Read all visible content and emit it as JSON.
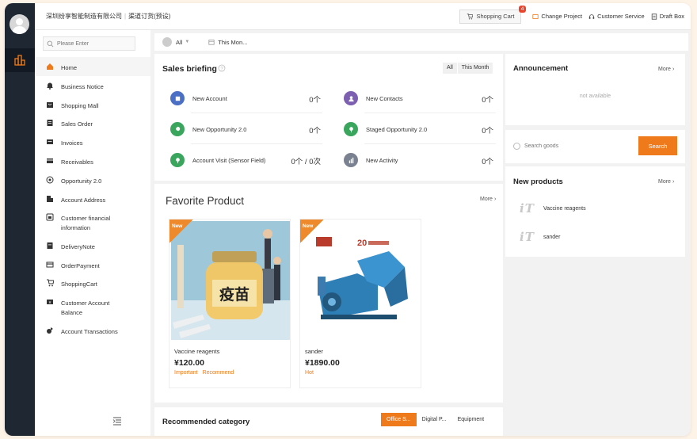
{
  "header": {
    "company": "深圳纷享智能制造有限公司",
    "channel": "渠道订货(预设)",
    "cart_label": "Shopping Cart",
    "cart_badge": "4",
    "change_project": "Change Project",
    "customer_service": "Customer Service",
    "draft_box": "Draft Box"
  },
  "sidebar": {
    "search_placeholder": "Please Enter",
    "items": [
      {
        "label": "Home",
        "icon": "home-icon"
      },
      {
        "label": "Business Notice",
        "icon": "bell-icon"
      },
      {
        "label": "Shopping Mall",
        "icon": "mall-icon"
      },
      {
        "label": "Sales Order",
        "icon": "order-icon"
      },
      {
        "label": "Invoices",
        "icon": "invoice-icon"
      },
      {
        "label": "Receivables",
        "icon": "receivables-icon"
      },
      {
        "label": "Opportunity 2.0",
        "icon": "target-icon"
      },
      {
        "label": "Account Address",
        "icon": "building-icon"
      },
      {
        "label": "Customer financial information",
        "icon": "finance-icon"
      },
      {
        "label": "DeliveryNote",
        "icon": "note-icon"
      },
      {
        "label": "OrderPayment",
        "icon": "payment-icon"
      },
      {
        "label": "ShoppingCart",
        "icon": "cart-icon"
      },
      {
        "label": "Customer Account Balance",
        "icon": "balance-icon"
      },
      {
        "label": "Account Transactions",
        "icon": "transactions-icon"
      }
    ]
  },
  "filter": {
    "owner": "All",
    "period": "This Mon..."
  },
  "briefing": {
    "title": "Sales briefing",
    "tabs": [
      "All",
      "This Month"
    ],
    "items": [
      {
        "label": "New Account",
        "value": "0个",
        "color": "#4a6fc4",
        "icon": "account-icon"
      },
      {
        "label": "New Contacts",
        "value": "0个",
        "color": "#7c5fb0",
        "icon": "contact-icon"
      },
      {
        "label": "New Opportunity 2.0",
        "value": "0个",
        "color": "#3aa55c",
        "icon": "opportunity-icon"
      },
      {
        "label": "Staged Opportunity 2.0",
        "value": "0个",
        "color": "#3aa55c",
        "icon": "staged-opportunity-icon"
      },
      {
        "label": "Account Visit (Sensor Field)",
        "value": "0个 / 0次",
        "color": "#3aa55c",
        "icon": "visit-icon"
      },
      {
        "label": "New Activity",
        "value": "0个",
        "color": "#7a8191",
        "icon": "activity-icon"
      }
    ]
  },
  "favorite": {
    "title": "Favorite Product",
    "more": "More",
    "products": [
      {
        "tag": "New",
        "name": "Vaccine reagents",
        "price": "¥120.00",
        "labels": [
          "Important",
          "Recommend"
        ],
        "img_text": "疫苗"
      },
      {
        "tag": "New",
        "name": "sander",
        "price": "¥1890.00",
        "labels": [
          "Hot"
        ],
        "img_text": "20"
      }
    ]
  },
  "recommended": {
    "title": "Recommended category",
    "tabs": [
      "Office S...",
      "Digital P...",
      "Equipment"
    ]
  },
  "announcement": {
    "title": "Announcement",
    "more": "More",
    "empty": "not available"
  },
  "search": {
    "placeholder": "Search goods",
    "button": "Search"
  },
  "new_products": {
    "title": "New products",
    "more": "More",
    "items": [
      {
        "logo": "iT",
        "name": "Vaccine reagents"
      },
      {
        "logo": "iT",
        "name": "sander"
      }
    ]
  },
  "colors": {
    "accent": "#ee7a1c",
    "rail": "#1f2733",
    "badge": "#e8452c"
  }
}
